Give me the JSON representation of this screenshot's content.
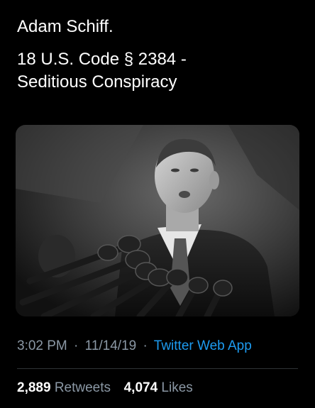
{
  "tweet": {
    "line1": "Adam Schiff.",
    "line2": "18 U.S. Code § 2384 -",
    "line3": "Seditious Conspiracy"
  },
  "meta": {
    "time": "3:02 PM",
    "separator": "·",
    "date": "11/14/19",
    "source": "Twitter Web App"
  },
  "stats": {
    "retweets_count": "2,889",
    "retweets_label": "Retweets",
    "likes_count": "4,074",
    "likes_label": "Likes"
  },
  "colors": {
    "background": "#000000",
    "text": "#ffffff",
    "muted": "#8b98a5",
    "link": "#1d9bf0",
    "divider": "#2f3336"
  },
  "media": {
    "description_icon": "photo-image"
  }
}
